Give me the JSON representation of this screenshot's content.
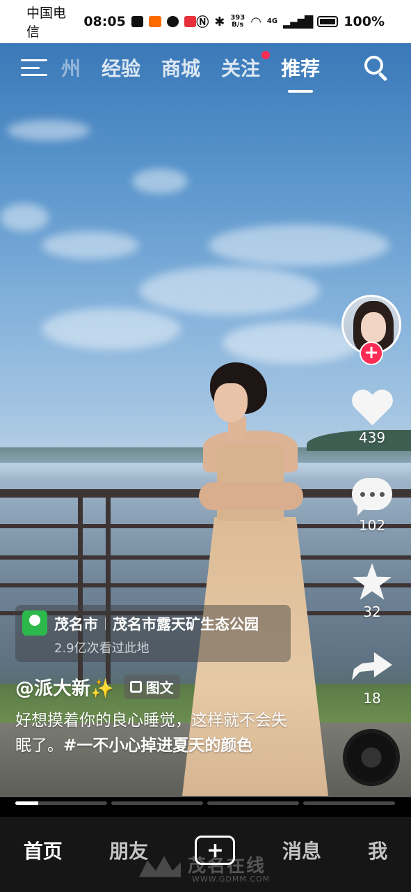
{
  "status_bar": {
    "carrier": "中国电信",
    "time": "08:05",
    "net_speed_value": "393",
    "net_speed_unit": "B/s",
    "network": "4G",
    "battery": "100%"
  },
  "top_nav": {
    "tabs": [
      {
        "label": "州"
      },
      {
        "label": "经验"
      },
      {
        "label": "商城"
      },
      {
        "label": "关注"
      },
      {
        "label": "推荐"
      }
    ],
    "active_tab": "推荐"
  },
  "actions": {
    "likes": "439",
    "comments": "102",
    "favorites": "32",
    "shares": "18",
    "follow_symbol": "+"
  },
  "location": {
    "city": "茂名市",
    "place": "茂名市露天矿生态公园",
    "views": "2.9亿次看过此地"
  },
  "post": {
    "author": "@派大新✨",
    "type_badge": "图文",
    "caption_text": "好想摸着你的良心睡觉，这样就不会失眠了。",
    "hashtag": "#一不小心掉进夏天的颜色"
  },
  "progress": {
    "segments": 4,
    "current_index": 0,
    "current_fill": 0.25
  },
  "bottom_nav": {
    "items": [
      "首页",
      "朋友",
      "消息",
      "我"
    ],
    "add_symbol": "+"
  },
  "watermark": {
    "text": "茂名在线",
    "url": "WWW.GDMM.COM"
  },
  "colors": {
    "accent_red": "#fe2c55",
    "location_green": "#2db84c"
  }
}
